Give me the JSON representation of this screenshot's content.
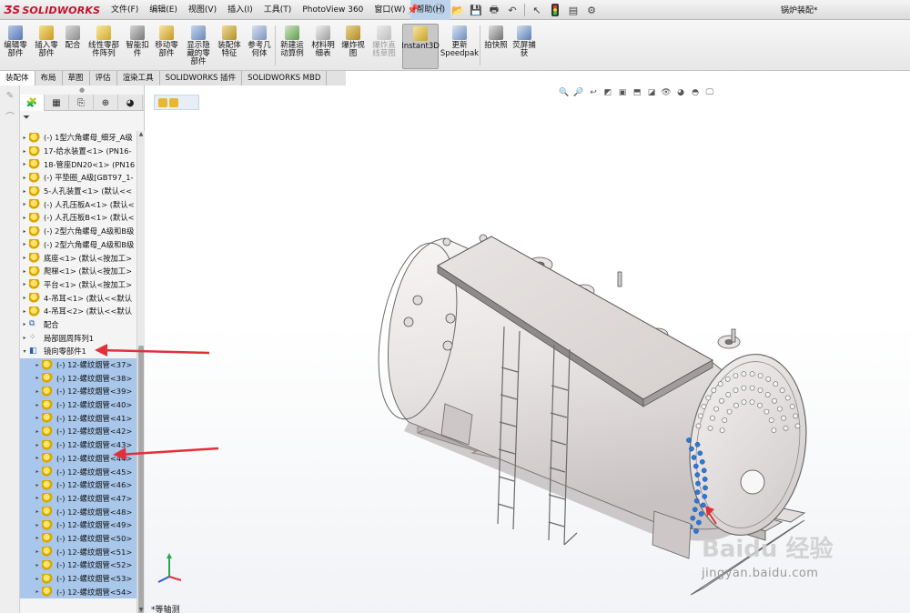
{
  "titlebar": {
    "brand": "SOLIDWORKS",
    "menus": [
      {
        "label": "文件(F)"
      },
      {
        "label": "编辑(E)"
      },
      {
        "label": "视图(V)"
      },
      {
        "label": "插入(I)"
      },
      {
        "label": "工具(T)"
      },
      {
        "label": "PhotoView 360"
      },
      {
        "label": "窗口(W)"
      },
      {
        "label": "帮助(H)"
      }
    ],
    "document_title": "锅炉装配*"
  },
  "commands": [
    {
      "label": "编辑零\n部件",
      "icon": "edit-component-icon",
      "disabled": false
    },
    {
      "label": "插入零\n部件",
      "icon": "insert-component-icon",
      "disabled": false
    },
    {
      "label": "配合",
      "icon": "mate-icon",
      "disabled": false
    },
    {
      "label": "线性零部\n件阵列",
      "icon": "linear-pattern-icon",
      "disabled": false
    },
    {
      "label": "智能扣\n件",
      "icon": "smart-fastener-icon",
      "disabled": false
    },
    {
      "label": "移动零\n部件",
      "icon": "move-component-icon",
      "disabled": false
    },
    {
      "label": "显示隐\n藏的零\n部件",
      "icon": "show-hidden-icon",
      "disabled": false
    },
    {
      "label": "装配体\n特征",
      "icon": "assembly-feature-icon",
      "disabled": false
    },
    {
      "label": "参考几\n何体",
      "icon": "reference-geometry-icon",
      "disabled": false
    },
    {
      "label": "新建运\n动算例",
      "icon": "motion-study-icon",
      "disabled": false
    },
    {
      "label": "材料明\n细表",
      "icon": "bom-icon",
      "disabled": false
    },
    {
      "label": "爆炸视\n图",
      "icon": "exploded-view-icon",
      "disabled": false
    },
    {
      "label": "爆炸直\n线草图",
      "icon": "explode-line-icon",
      "disabled": true
    },
    {
      "label": "Instant3D",
      "icon": "instant3d-icon",
      "disabled": false,
      "pressed": true
    },
    {
      "label": "更新\nSpeedpak",
      "icon": "speedpak-icon",
      "disabled": false
    },
    {
      "label": "拍快照",
      "icon": "snapshot-icon",
      "disabled": false
    },
    {
      "label": "荧屏捕\n获",
      "icon": "screen-capture-icon",
      "disabled": false
    }
  ],
  "tabs": [
    {
      "label": "装配体",
      "active": true
    },
    {
      "label": "布局",
      "active": false
    },
    {
      "label": "草图",
      "active": false
    },
    {
      "label": "评估",
      "active": false
    },
    {
      "label": "渲染工具",
      "active": false
    },
    {
      "label": "SOLIDWORKS 插件",
      "active": false
    },
    {
      "label": "SOLIDWORKS MBD",
      "active": false
    }
  ],
  "tree": [
    {
      "label": "(-) 1型六角螺母_细牙_A级",
      "kind": "part",
      "indent": 0,
      "selected": false
    },
    {
      "label": "17-给水装置<1> (PN16-",
      "kind": "part",
      "indent": 0,
      "selected": false
    },
    {
      "label": "18-管座DN20<1> (PN16",
      "kind": "part",
      "indent": 0,
      "selected": false
    },
    {
      "label": "(-) 平垫圈_A级[GBT97_1-",
      "kind": "part",
      "indent": 0,
      "selected": false
    },
    {
      "label": "5-人孔装置<1> (默认<<",
      "kind": "part",
      "indent": 0,
      "selected": false
    },
    {
      "label": "(-) 人孔压板A<1> (默认<",
      "kind": "part",
      "indent": 0,
      "selected": false
    },
    {
      "label": "(-) 人孔压板B<1> (默认<",
      "kind": "part",
      "indent": 0,
      "selected": false
    },
    {
      "label": "(-) 2型六角螺母_A级和B级",
      "kind": "part",
      "indent": 0,
      "selected": false
    },
    {
      "label": "(-) 2型六角螺母_A级和B级",
      "kind": "part",
      "indent": 0,
      "selected": false
    },
    {
      "label": "底座<1> (默认<按加工>",
      "kind": "part",
      "indent": 0,
      "selected": false
    },
    {
      "label": "爬梯<1> (默认<按加工>",
      "kind": "part",
      "indent": 0,
      "selected": false
    },
    {
      "label": "平台<1> (默认<按加工>",
      "kind": "part",
      "indent": 0,
      "selected": false
    },
    {
      "label": "4-吊耳<1> (默认<<默认",
      "kind": "part",
      "indent": 0,
      "selected": false
    },
    {
      "label": "4-吊耳<2> (默认<<默认",
      "kind": "part",
      "indent": 0,
      "selected": false
    },
    {
      "label": "配合",
      "kind": "mate",
      "indent": 0,
      "selected": false
    },
    {
      "label": "局部圆周阵列1",
      "kind": "pattern",
      "indent": 0,
      "selected": false
    },
    {
      "label": "镜向零部件1",
      "kind": "mirror",
      "indent": 0,
      "selected": false,
      "expanded": true
    },
    {
      "label": "(-) 12-螺纹烟管<37>",
      "kind": "part",
      "indent": 1,
      "selected": true
    },
    {
      "label": "(-) 12-螺纹烟管<38>",
      "kind": "part",
      "indent": 1,
      "selected": true
    },
    {
      "label": "(-) 12-螺纹烟管<39>",
      "kind": "part",
      "indent": 1,
      "selected": true
    },
    {
      "label": "(-) 12-螺纹烟管<40>",
      "kind": "part",
      "indent": 1,
      "selected": true
    },
    {
      "label": "(-) 12-螺纹烟管<41>",
      "kind": "part",
      "indent": 1,
      "selected": true
    },
    {
      "label": "(-) 12-螺纹烟管<42>",
      "kind": "part",
      "indent": 1,
      "selected": true
    },
    {
      "label": "(-) 12-螺纹烟管<43>",
      "kind": "part",
      "indent": 1,
      "selected": true
    },
    {
      "label": "(-) 12-螺纹烟管<44>",
      "kind": "part",
      "indent": 1,
      "selected": true
    },
    {
      "label": "(-) 12-螺纹烟管<45>",
      "kind": "part",
      "indent": 1,
      "selected": true
    },
    {
      "label": "(-) 12-螺纹烟管<46>",
      "kind": "part",
      "indent": 1,
      "selected": true
    },
    {
      "label": "(-) 12-螺纹烟管<47>",
      "kind": "part",
      "indent": 1,
      "selected": true
    },
    {
      "label": "(-) 12-螺纹烟管<48>",
      "kind": "part",
      "indent": 1,
      "selected": true
    },
    {
      "label": "(-) 12-螺纹烟管<49>",
      "kind": "part",
      "indent": 1,
      "selected": true
    },
    {
      "label": "(-) 12-螺纹烟管<50>",
      "kind": "part",
      "indent": 1,
      "selected": true
    },
    {
      "label": "(-) 12-螺纹烟管<51>",
      "kind": "part",
      "indent": 1,
      "selected": true
    },
    {
      "label": "(-) 12-螺纹烟管<52>",
      "kind": "part",
      "indent": 1,
      "selected": true
    },
    {
      "label": "(-) 12-螺纹烟管<53>",
      "kind": "part",
      "indent": 1,
      "selected": true
    },
    {
      "label": "(-) 12-螺纹烟管<54>",
      "kind": "part",
      "indent": 1,
      "selected": true
    }
  ],
  "graphics": {
    "view_name": "*等轴测",
    "watermark": "Baidu 经验",
    "watermark_url": "jingyan.baidu.com",
    "annotation_color": "#e0313a",
    "selection_color": "#a8c7ea"
  }
}
